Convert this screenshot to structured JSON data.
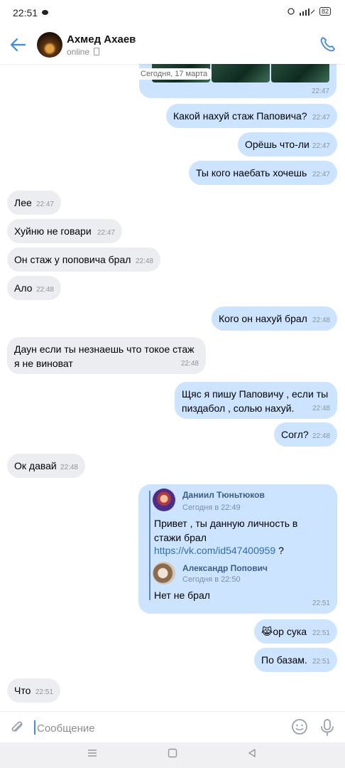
{
  "status": {
    "time": "22:51",
    "battery": "82"
  },
  "header": {
    "name": "Ахмед Ахаев",
    "status": "online"
  },
  "top_media": {
    "date": "Сегодня, 17 марта",
    "time": "22:47"
  },
  "messages": [
    {
      "text": "Какой нахуй стаж Паповича?",
      "time": "22:47"
    },
    {
      "text": "Орёшь что-ли",
      "time": "22:47"
    },
    {
      "text": "Ты кого наебать хочешь",
      "time": "22:47"
    },
    {
      "text": "Лее",
      "time": "22:47"
    },
    {
      "text": "Хуйню не говари",
      "time": "22:47"
    },
    {
      "text": "Он стаж у поповича брал",
      "time": "22:48"
    },
    {
      "text": "Ало",
      "time": "22:48"
    },
    {
      "text": "Кого он нахуй брал",
      "time": "22:48"
    },
    {
      "text": "Даун если ты незнаешь что токое стаж",
      "text2": "я не виноват",
      "time": "22:48"
    },
    {
      "text": "Щяс я пишу Паповичу , если  ты",
      "text2": "пиздабол , солью нахуй.",
      "time": "22:48"
    },
    {
      "text": "Согл?",
      "time": "22:48"
    },
    {
      "text": "Ок давай",
      "time": "22:48"
    },
    {
      "text": "ор сука",
      "emoji": "😹",
      "time": "22:51"
    },
    {
      "text": "По базам.",
      "time": "22:51"
    },
    {
      "text": "Что",
      "time": "22:51"
    }
  ],
  "forwarded": {
    "time": "22:51",
    "first": {
      "name": "Даниил Тюньтюков",
      "when": "Сегодня в 22:49",
      "line1": "Привет , ты данную личность в",
      "line2": "стажи брал",
      "link": "https://vk.com/id547400959",
      "after_link": " ?"
    },
    "second": {
      "name": "Александр Попович",
      "when": "Сегодня в 22:50",
      "text": "Нет не брал"
    }
  },
  "input": {
    "placeholder": "Сообщение"
  },
  "colors": {
    "out_bubble": "#cce4ff",
    "in_bubble": "#ebedf0",
    "accent": "#3f8ae0"
  },
  "icons": [
    "back-arrow-icon",
    "phone-icon",
    "attach-icon",
    "emoji-icon",
    "mic-icon"
  ]
}
